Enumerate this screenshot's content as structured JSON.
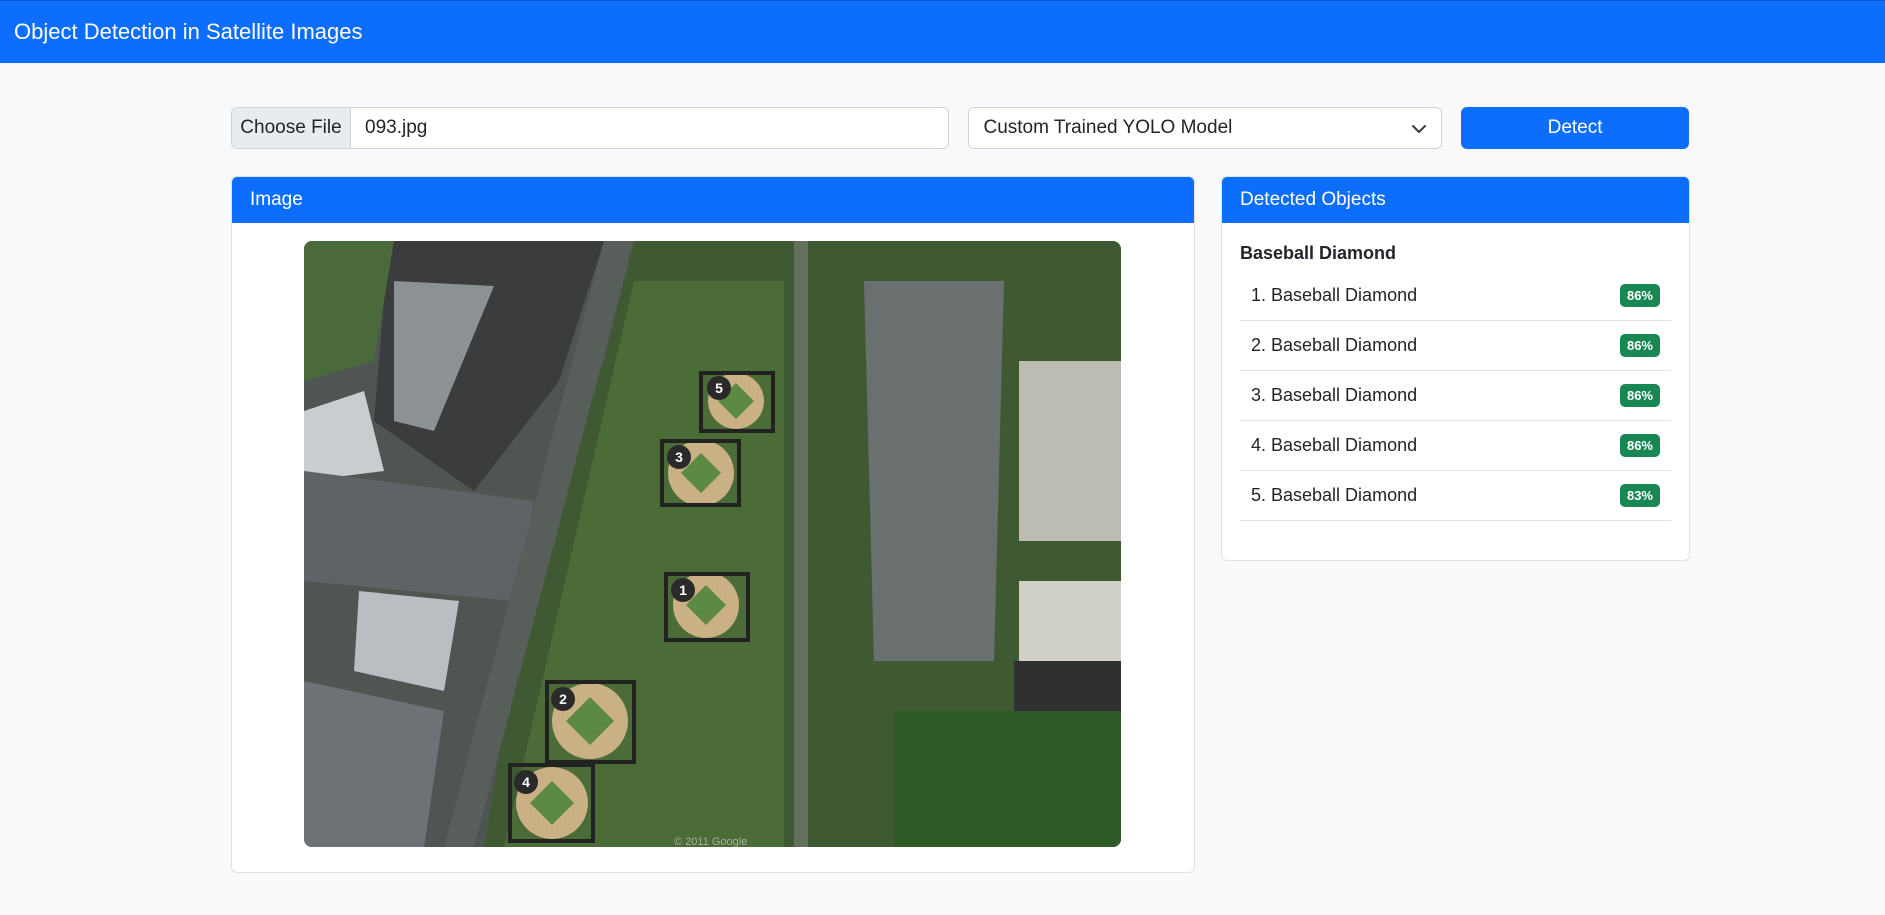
{
  "navbar": {
    "title": "Object Detection in Satellite Images"
  },
  "controls": {
    "file_button": "Choose File",
    "file_name": "093.jpg",
    "model_select": "Custom Trained YOLO Model",
    "detect_button": "Detect"
  },
  "image_card": {
    "header": "Image",
    "markers": [
      "1",
      "2",
      "3",
      "4",
      "5"
    ],
    "attribution": "© 2011 Google"
  },
  "objects_card": {
    "header": "Detected Objects",
    "group_title": "Baseball Diamond",
    "items": [
      {
        "label": "1. Baseball Diamond",
        "confidence": "86%"
      },
      {
        "label": "2. Baseball Diamond",
        "confidence": "86%"
      },
      {
        "label": "3. Baseball Diamond",
        "confidence": "86%"
      },
      {
        "label": "4. Baseball Diamond",
        "confidence": "86%"
      },
      {
        "label": "5. Baseball Diamond",
        "confidence": "83%"
      }
    ]
  },
  "colors": {
    "primary": "#0d6efd",
    "success": "#198754",
    "background": "#f8f9fa"
  }
}
